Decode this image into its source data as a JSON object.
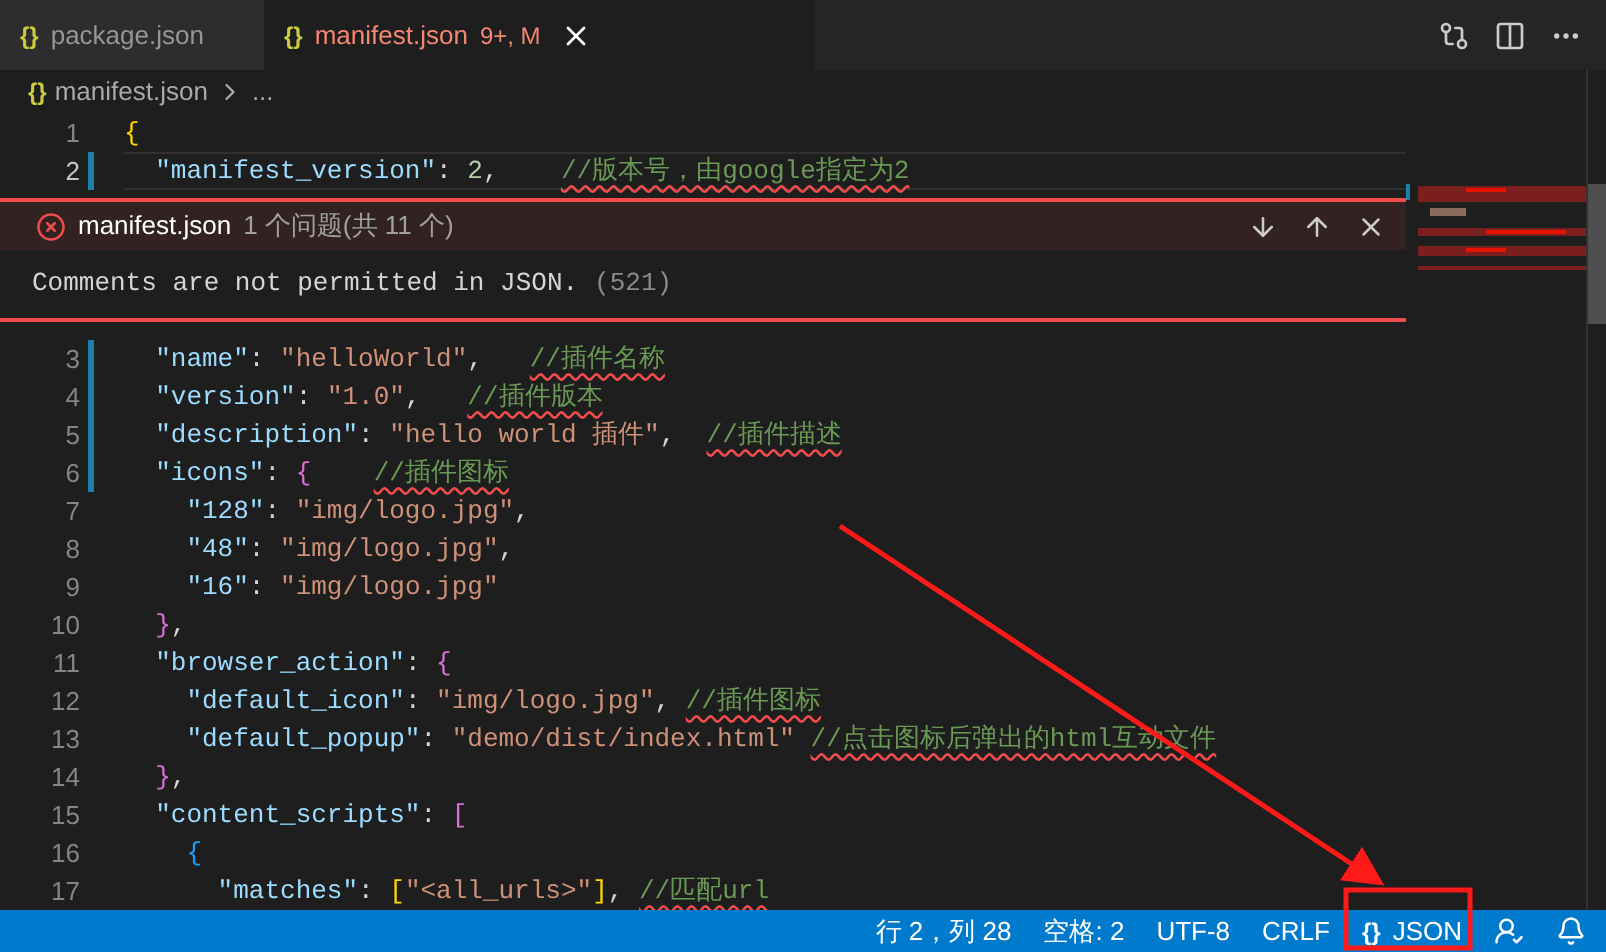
{
  "tabs": [
    {
      "icon": "{}",
      "label": "package.json",
      "selected": false,
      "error": false
    },
    {
      "icon": "{}",
      "label": "manifest.json",
      "badge": "9+, M",
      "selected": true,
      "error": true
    }
  ],
  "breadcrumb": {
    "icon": "{}",
    "file": "manifest.json",
    "more": "..."
  },
  "lines_before": [
    {
      "number": "1",
      "modified": false,
      "current": false,
      "tokens": [
        {
          "kind": "bracket1",
          "text": "{"
        }
      ]
    },
    {
      "number": "2",
      "modified": true,
      "current": true,
      "tokens": [
        {
          "kind": "key",
          "text": "  \"manifest_version\""
        },
        {
          "kind": "punct",
          "text": ": "
        },
        {
          "kind": "number",
          "text": "2"
        },
        {
          "kind": "punct",
          "text": ",    "
        },
        {
          "kind": "comment",
          "text": "//版本号，由google指定为2"
        }
      ]
    }
  ],
  "problem": {
    "file": "manifest.json",
    "count": "1 个问题(共 11 个)",
    "message": "Comments are not permitted in JSON.",
    "code": "(521)"
  },
  "lines_after": [
    {
      "number": "3",
      "modified": true,
      "current": false,
      "tokens": [
        {
          "kind": "key",
          "text": "  \"name\""
        },
        {
          "kind": "punct",
          "text": ": "
        },
        {
          "kind": "string",
          "text": "\"helloWorld\""
        },
        {
          "kind": "punct",
          "text": ",   "
        },
        {
          "kind": "comment",
          "text": "//插件名称"
        }
      ]
    },
    {
      "number": "4",
      "modified": true,
      "current": false,
      "tokens": [
        {
          "kind": "key",
          "text": "  \"version\""
        },
        {
          "kind": "punct",
          "text": ": "
        },
        {
          "kind": "string",
          "text": "\"1.0\""
        },
        {
          "kind": "punct",
          "text": ",   "
        },
        {
          "kind": "comment",
          "text": "//插件版本"
        }
      ]
    },
    {
      "number": "5",
      "modified": true,
      "current": false,
      "tokens": [
        {
          "kind": "key",
          "text": "  \"description\""
        },
        {
          "kind": "punct",
          "text": ": "
        },
        {
          "kind": "string",
          "text": "\"hello world 插件\""
        },
        {
          "kind": "punct",
          "text": ",  "
        },
        {
          "kind": "comment",
          "text": "//插件描述"
        }
      ]
    },
    {
      "number": "6",
      "modified": true,
      "current": false,
      "tokens": [
        {
          "kind": "key",
          "text": "  \"icons\""
        },
        {
          "kind": "punct",
          "text": ": "
        },
        {
          "kind": "bracket2",
          "text": "{    "
        },
        {
          "kind": "comment",
          "text": "//插件图标"
        }
      ]
    },
    {
      "number": "7",
      "modified": false,
      "current": false,
      "tokens": [
        {
          "kind": "key",
          "text": "    \"128\""
        },
        {
          "kind": "punct",
          "text": ": "
        },
        {
          "kind": "string",
          "text": "\"img/logo.jpg\""
        },
        {
          "kind": "punct",
          "text": ","
        }
      ]
    },
    {
      "number": "8",
      "modified": false,
      "current": false,
      "tokens": [
        {
          "kind": "key",
          "text": "    \"48\""
        },
        {
          "kind": "punct",
          "text": ": "
        },
        {
          "kind": "string",
          "text": "\"img/logo.jpg\""
        },
        {
          "kind": "punct",
          "text": ","
        }
      ]
    },
    {
      "number": "9",
      "modified": false,
      "current": false,
      "tokens": [
        {
          "kind": "key",
          "text": "    \"16\""
        },
        {
          "kind": "punct",
          "text": ": "
        },
        {
          "kind": "string",
          "text": "\"img/logo.jpg\""
        }
      ]
    },
    {
      "number": "10",
      "modified": false,
      "current": false,
      "tokens": [
        {
          "kind": "bracket2",
          "text": "  }"
        },
        {
          "kind": "punct",
          "text": ","
        }
      ]
    },
    {
      "number": "11",
      "modified": false,
      "current": false,
      "tokens": [
        {
          "kind": "key",
          "text": "  \"browser_action\""
        },
        {
          "kind": "punct",
          "text": ": "
        },
        {
          "kind": "bracket2",
          "text": "{"
        }
      ]
    },
    {
      "number": "12",
      "modified": false,
      "current": false,
      "tokens": [
        {
          "kind": "key",
          "text": "    \"default_icon\""
        },
        {
          "kind": "punct",
          "text": ": "
        },
        {
          "kind": "string",
          "text": "\"img/logo.jpg\""
        },
        {
          "kind": "punct",
          "text": ", "
        },
        {
          "kind": "comment",
          "text": "//插件图标"
        }
      ]
    },
    {
      "number": "13",
      "modified": false,
      "current": false,
      "tokens": [
        {
          "kind": "key",
          "text": "    \"default_popup\""
        },
        {
          "kind": "punct",
          "text": ": "
        },
        {
          "kind": "string",
          "text": "\"demo/dist/index.html\" "
        },
        {
          "kind": "comment",
          "text": "//点击图标后弹出的html互动文件"
        }
      ]
    },
    {
      "number": "14",
      "modified": false,
      "current": false,
      "tokens": [
        {
          "kind": "bracket2",
          "text": "  }"
        },
        {
          "kind": "punct",
          "text": ","
        }
      ]
    },
    {
      "number": "15",
      "modified": false,
      "current": false,
      "tokens": [
        {
          "kind": "key",
          "text": "  \"content_scripts\""
        },
        {
          "kind": "punct",
          "text": ": "
        },
        {
          "kind": "bracket2",
          "text": "["
        }
      ]
    },
    {
      "number": "16",
      "modified": false,
      "current": false,
      "tokens": [
        {
          "kind": "bracket3",
          "text": "    {"
        }
      ]
    },
    {
      "number": "17",
      "modified": false,
      "current": false,
      "tokens": [
        {
          "kind": "key",
          "text": "      \"matches\""
        },
        {
          "kind": "punct",
          "text": ": "
        },
        {
          "kind": "bracket1",
          "text": "["
        },
        {
          "kind": "string",
          "text": "\"<all_urls>\""
        },
        {
          "kind": "bracket1",
          "text": "]"
        },
        {
          "kind": "punct",
          "text": ", "
        },
        {
          "kind": "comment",
          "text": "//匹配url"
        }
      ]
    }
  ],
  "status_bar": {
    "position": "行 2，列 28",
    "indent": "空格: 2",
    "encoding": "UTF-8",
    "eol": "CRLF",
    "language_icon": "{}",
    "language": "JSON"
  }
}
